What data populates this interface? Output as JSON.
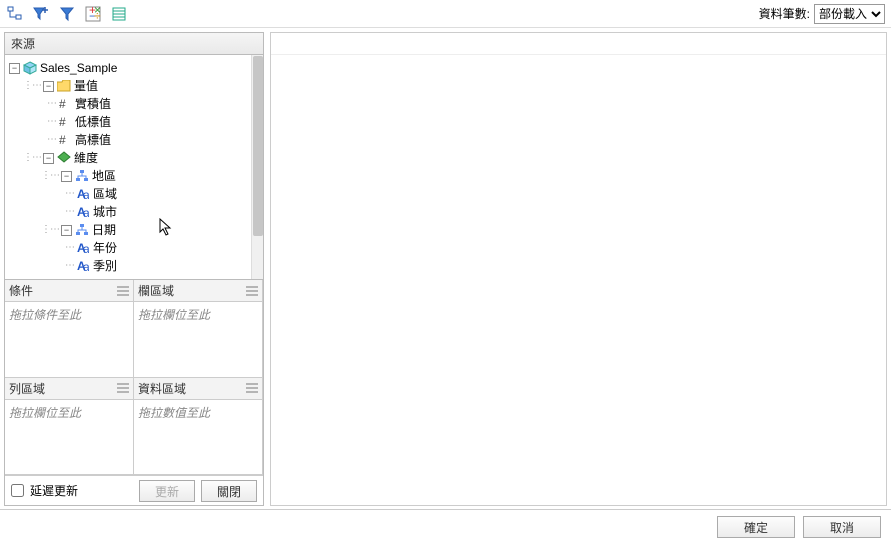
{
  "toolbar": {
    "record_count_label": "資料筆數:",
    "load_select_value": "部份載入"
  },
  "source": {
    "header": "來源",
    "root": "Sales_Sample",
    "measures_label": "量值",
    "measures": [
      "實積值",
      "低標值",
      "高標值"
    ],
    "dimensions_label": "維度",
    "dim_region": {
      "label": "地區",
      "children": [
        "區域",
        "城市"
      ]
    },
    "dim_date": {
      "label": "日期",
      "children": [
        "年份",
        "季別"
      ]
    }
  },
  "dropzones": {
    "filter": {
      "title": "條件",
      "hint": "拖拉條件至此"
    },
    "columns": {
      "title": "欄區域",
      "hint": "拖拉欄位至此"
    },
    "rows": {
      "title": "列區域",
      "hint": "拖拉欄位至此"
    },
    "data": {
      "title": "資料區域",
      "hint": "拖拉數值至此"
    }
  },
  "controls": {
    "defer_update": "延遲更新",
    "update_btn": "更新",
    "close_btn": "關閉"
  },
  "footer": {
    "ok": "確定",
    "cancel": "取消"
  }
}
